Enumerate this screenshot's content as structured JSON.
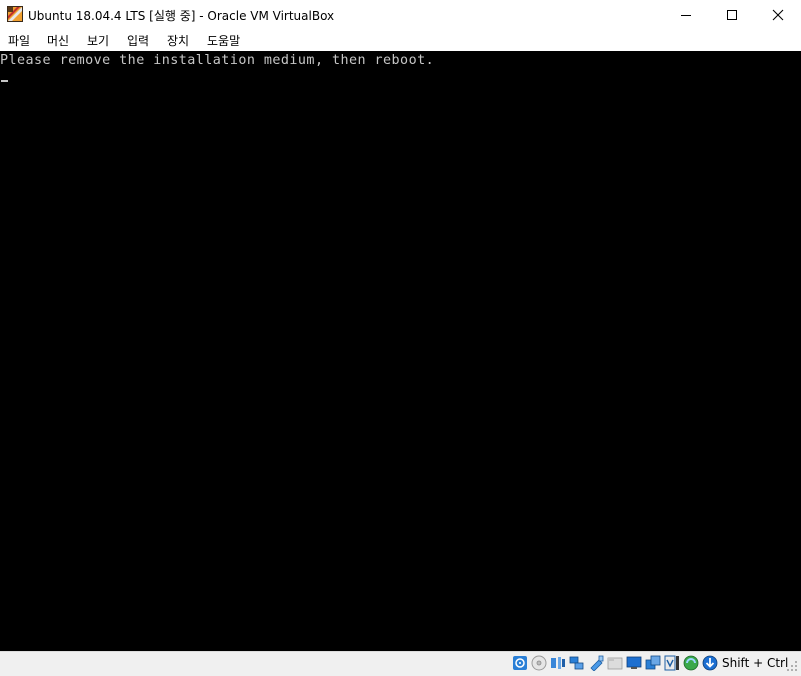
{
  "window": {
    "title": "Ubuntu 18.04.4 LTS [실행 중] - Oracle VM VirtualBox"
  },
  "menu": {
    "items": [
      "파일",
      "머신",
      "보기",
      "입력",
      "장치",
      "도움말"
    ]
  },
  "console": {
    "line1": "Please remove the installation medium, then reboot."
  },
  "statusbar": {
    "host_key": "Shift + Ctrl",
    "icons": [
      "hard-disk-icon",
      "optical-drive-icon",
      "audio-icon",
      "network-icon",
      "usb-icon",
      "shared-folders-icon",
      "display-icon",
      "recording-icon",
      "virtualization-icon",
      "mouse-integration-icon",
      "keyboard-capture-icon"
    ]
  },
  "colors": {
    "screen_bg": "#000000",
    "console_text": "#c6c6c6",
    "accent": "#1c6fd2"
  }
}
